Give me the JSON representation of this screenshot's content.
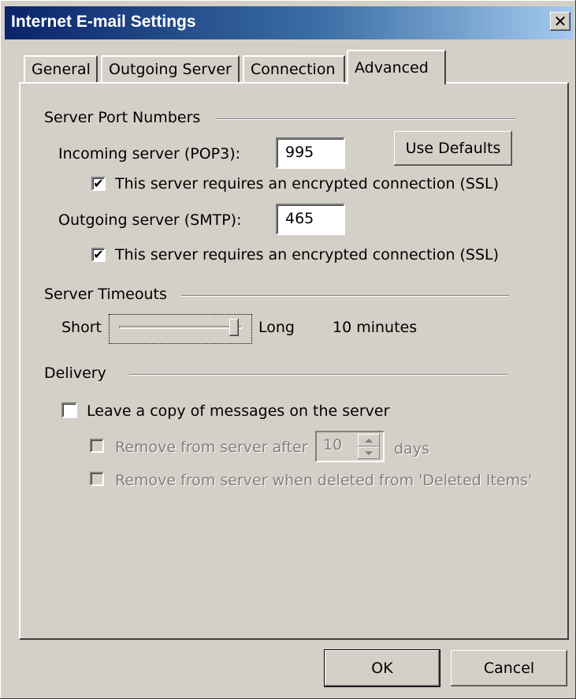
{
  "window": {
    "title": "Internet E-mail Settings",
    "close_glyph": "✕"
  },
  "tabs": [
    {
      "label": "General",
      "active": false
    },
    {
      "label": "Outgoing Server",
      "active": false
    },
    {
      "label": "Connection",
      "active": false
    },
    {
      "label": "Advanced",
      "active": true
    }
  ],
  "ports": {
    "group_label": "Server Port Numbers",
    "incoming_label": "Incoming server (POP3):",
    "incoming_value": "995",
    "incoming_ssl_label": "This server requires an encrypted connection (SSL)",
    "incoming_ssl_checked": true,
    "outgoing_label": "Outgoing server (SMTP):",
    "outgoing_value": "465",
    "outgoing_ssl_label": "This server requires an encrypted connection (SSL)",
    "outgoing_ssl_checked": true,
    "use_defaults_label": "Use Defaults"
  },
  "timeouts": {
    "group_label": "Server Timeouts",
    "short_label": "Short",
    "long_label": "Long",
    "value_text": "10 minutes",
    "slider_fraction": 1.0
  },
  "delivery": {
    "group_label": "Delivery",
    "leave_copy_label": "Leave a copy of messages on the server",
    "leave_copy_checked": false,
    "remove_after_label": "Remove from server after",
    "remove_after_value": "10",
    "days_label": "days",
    "remove_deleted_label": "Remove from server when deleted from 'Deleted Items'"
  },
  "footer": {
    "ok_label": "OK",
    "cancel_label": "Cancel"
  },
  "icons": {
    "check": "check-icon",
    "spin_up": "arrow-up-icon",
    "spin_down": "arrow-down-icon"
  }
}
